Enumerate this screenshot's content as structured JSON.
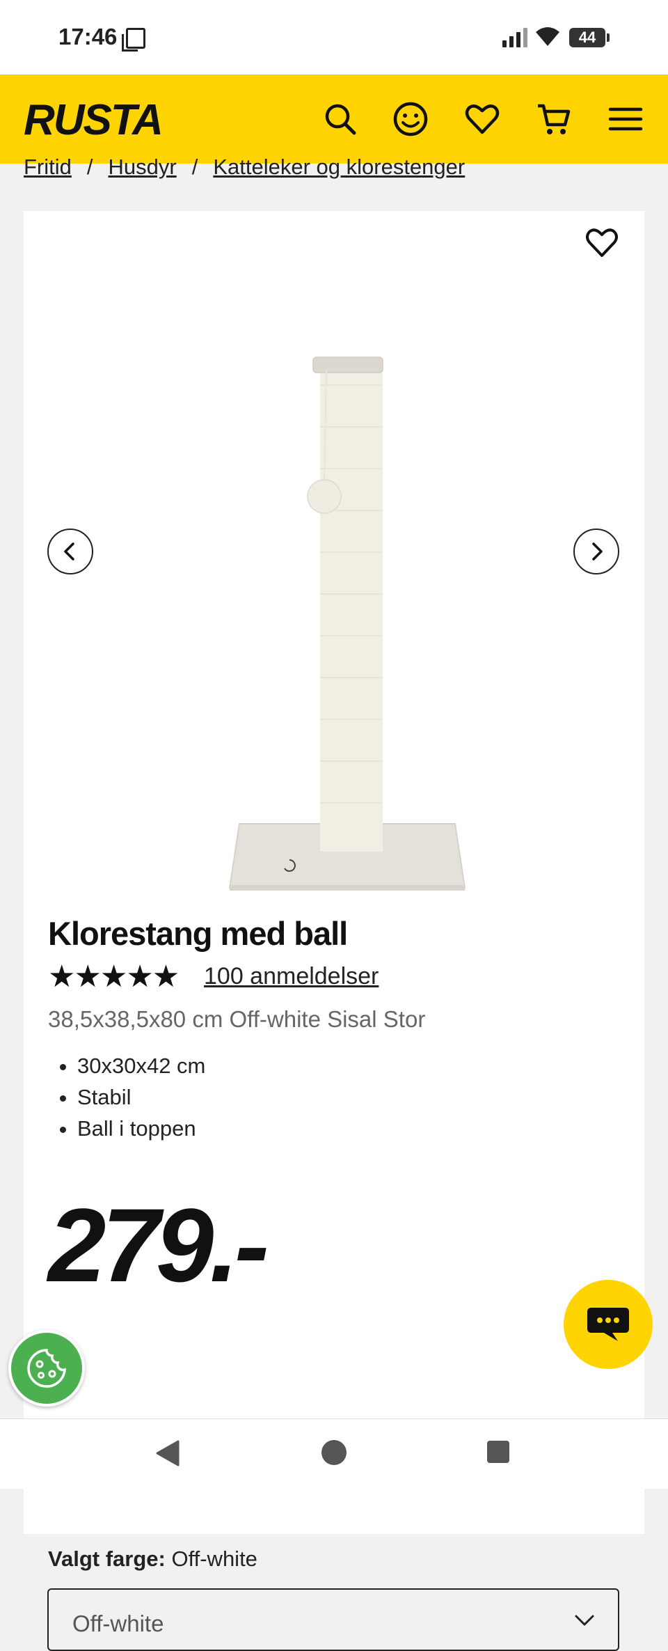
{
  "status_bar": {
    "time": "17:46",
    "battery": "44"
  },
  "header": {
    "logo": "RUSTA"
  },
  "breadcrumb": [
    "Fritid",
    "Husdyr",
    "Katteleker og klorestenger"
  ],
  "breadcrumb_separator": "/",
  "product": {
    "title": "Klorestang med ball",
    "stars": "★★★★★",
    "rating_count_label": "100 anmeldelser",
    "variant": "38,5x38,5x80 cm Off-white Sisal Stor",
    "features": [
      "30x30x42 cm",
      "Stabil",
      "Ball i toppen"
    ],
    "price": "279.-",
    "color_label": "Valgt farge:",
    "color_value": "Off-white",
    "color_select_value": "Off-white"
  },
  "icons": {
    "header": [
      "search-icon",
      "account-icon",
      "heart-icon",
      "cart-icon",
      "menu-icon"
    ],
    "gallery": [
      "favorite-heart-icon",
      "chevron-left-icon",
      "chevron-right-icon"
    ],
    "floating": [
      "chat-icon",
      "cookie-icon"
    ],
    "system_nav": [
      "back-icon",
      "home-icon",
      "recents-icon"
    ]
  },
  "colors": {
    "brand_yellow": "#ffd400",
    "cookie_green": "#4caf50"
  }
}
